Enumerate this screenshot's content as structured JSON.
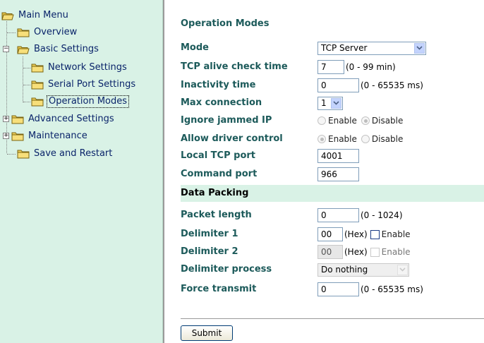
{
  "sidebar": {
    "items": [
      {
        "label": "Main Menu",
        "selected": false
      },
      {
        "label": "Overview",
        "selected": false
      },
      {
        "label": "Basic Settings",
        "selected": false
      },
      {
        "label": "Network Settings",
        "selected": false
      },
      {
        "label": "Serial Port Settings",
        "selected": false
      },
      {
        "label": "Operation Modes",
        "selected": true
      },
      {
        "label": "Advanced Settings",
        "selected": false
      },
      {
        "label": "Maintenance",
        "selected": false
      },
      {
        "label": "Save and Restart",
        "selected": false
      }
    ],
    "expand_marks": {
      "basic": "−",
      "advanced": "+",
      "maintenance": "+"
    }
  },
  "page": {
    "title": "Operation Modes",
    "mode": {
      "label": "Mode",
      "value": "TCP Server"
    },
    "alive": {
      "label": "TCP alive check time",
      "value": "7",
      "hint": "(0 - 99 min)"
    },
    "inactivity": {
      "label": "Inactivity time",
      "value": "0",
      "hint": "(0 - 65535 ms)"
    },
    "maxconn": {
      "label": "Max connection",
      "value": "1"
    },
    "jammed": {
      "label": "Ignore jammed IP",
      "opt1": "Enable",
      "opt2": "Disable",
      "selected": "Disable"
    },
    "driver": {
      "label": "Allow driver control",
      "opt1": "Enable",
      "opt2": "Disable",
      "selected": "Enable"
    },
    "localport": {
      "label": "Local TCP port",
      "value": "4001"
    },
    "cmdport": {
      "label": "Command port",
      "value": "966"
    },
    "section": "Data Packing",
    "packet": {
      "label": "Packet length",
      "value": "0",
      "hint": "(0 - 1024)"
    },
    "delim1": {
      "label": "Delimiter 1",
      "value": "00",
      "hex": "(Hex)",
      "enable": "Enable"
    },
    "delim2": {
      "label": "Delimiter 2",
      "value": "00",
      "hex": "(Hex)",
      "enable": "Enable"
    },
    "delimproc": {
      "label": "Delimiter process",
      "value": "Do nothing"
    },
    "force": {
      "label": "Force transmit",
      "value": "0",
      "hint": "(0 - 65535 ms)"
    },
    "submit": "Submit"
  },
  "colors": {
    "sidebar_bg": "#d9f2e6",
    "label_color": "#1c5a5a",
    "link_color": "#0a246a"
  }
}
